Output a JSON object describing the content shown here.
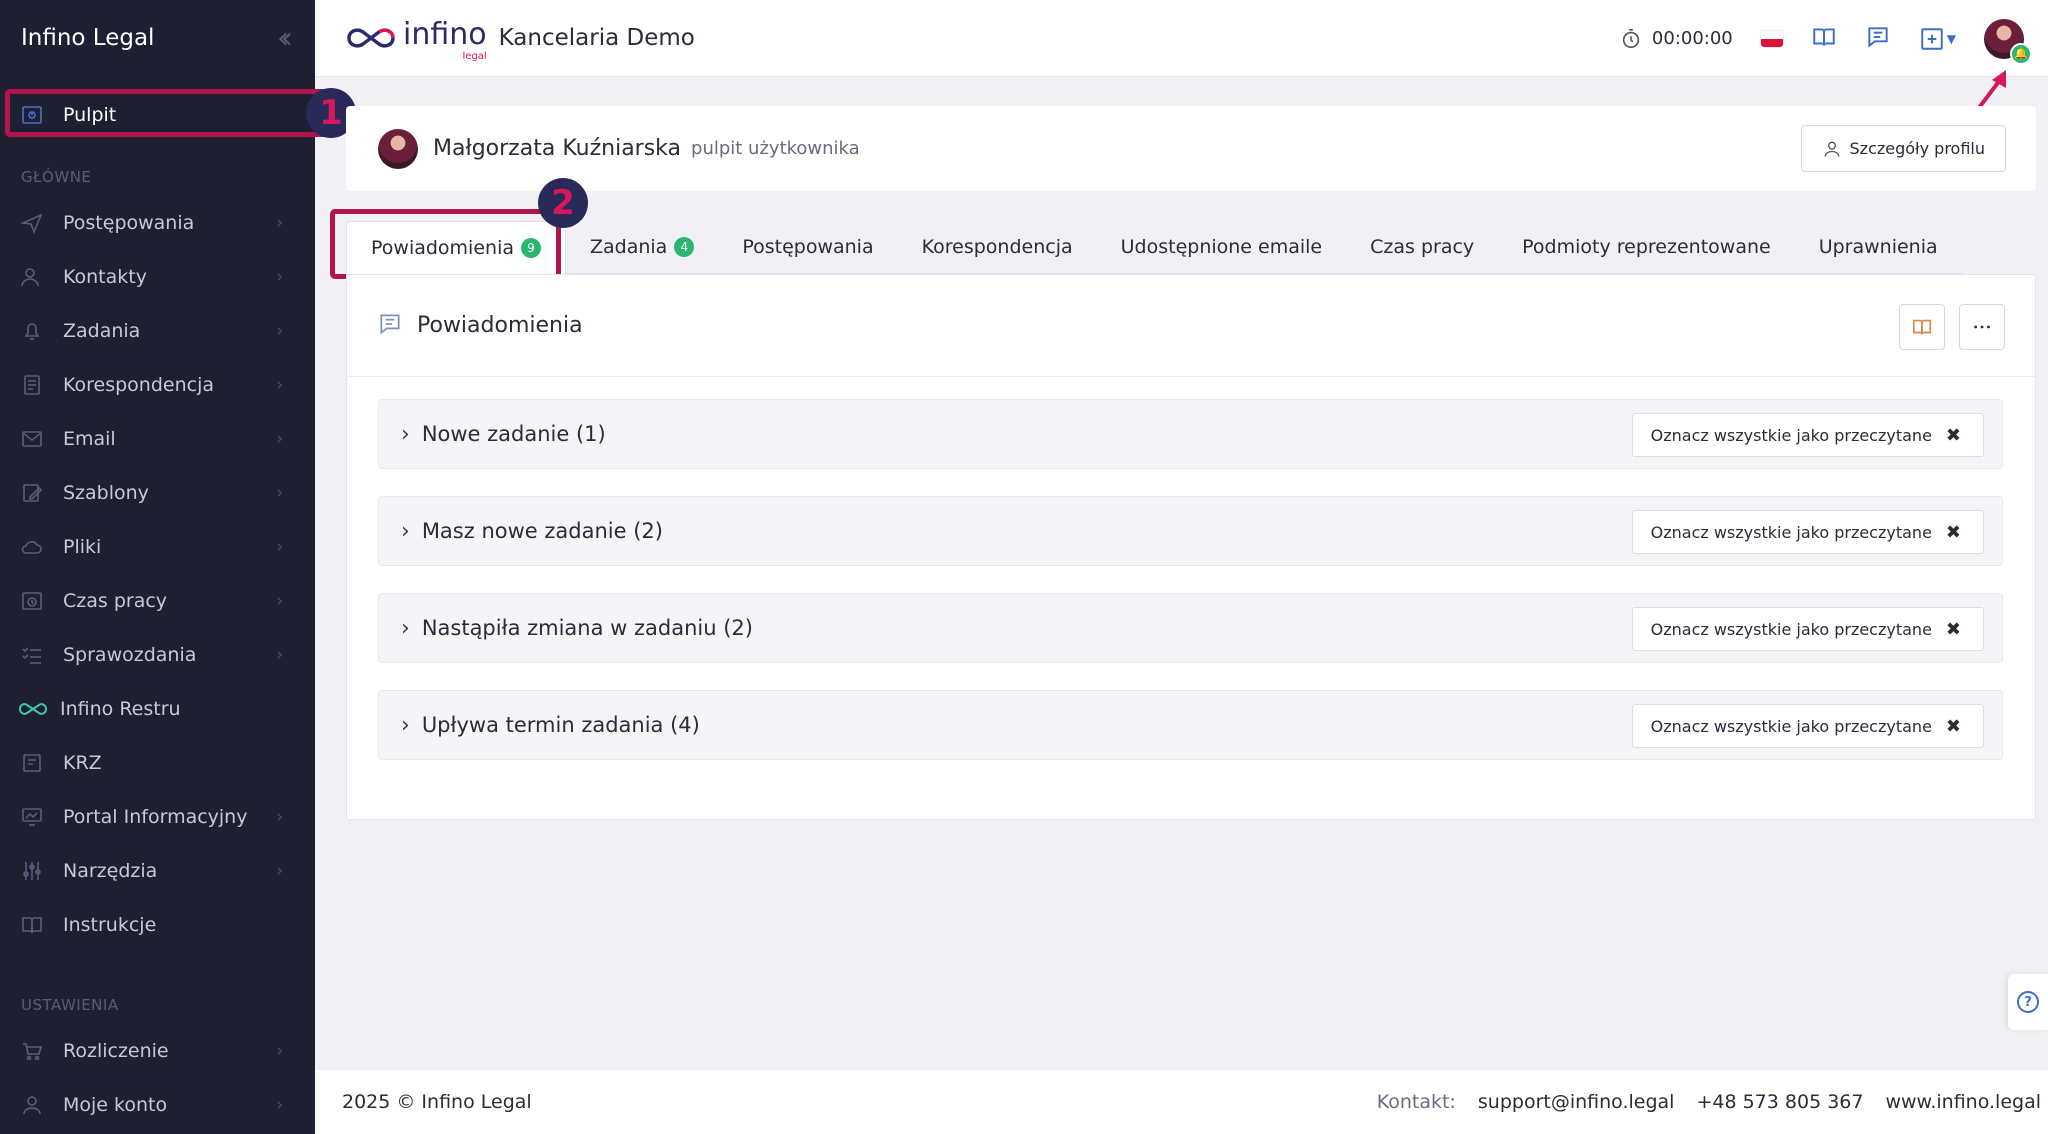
{
  "sidebar": {
    "title": "Infino Legal",
    "active_item": "Pulpit",
    "section_main": "GŁÓWNE",
    "section_settings": "USTAWIENIA",
    "items": [
      {
        "label": "Postępowania",
        "icon": "send-icon"
      },
      {
        "label": "Kontakty",
        "icon": "users-icon"
      },
      {
        "label": "Zadania",
        "icon": "bell-icon"
      },
      {
        "label": "Korespondencja",
        "icon": "document-icon"
      },
      {
        "label": "Email",
        "icon": "mail-icon"
      },
      {
        "label": "Szablony",
        "icon": "edit-icon"
      },
      {
        "label": "Pliki",
        "icon": "cloud-icon"
      },
      {
        "label": "Czas pracy",
        "icon": "clock-icon"
      },
      {
        "label": "Sprawozdania",
        "icon": "checklist-icon"
      },
      {
        "label": "Infino Restru",
        "icon": "infinity-icon"
      },
      {
        "label": "KRZ",
        "icon": "folder-icon"
      },
      {
        "label": "Portal Informacyjny",
        "icon": "monitor-icon"
      },
      {
        "label": "Narzędzia",
        "icon": "sliders-icon"
      },
      {
        "label": "Instrukcje",
        "icon": "book-icon"
      }
    ],
    "settings_items": [
      {
        "label": "Rozliczenie",
        "icon": "cart-icon"
      },
      {
        "label": "Moje konto",
        "icon": "user-icon"
      }
    ]
  },
  "annotations": {
    "step1": "1",
    "step2": "2"
  },
  "topbar": {
    "logo_word": "infino",
    "logo_sub": "legal",
    "office": "Kancelaria Demo",
    "timer": "00:00:00"
  },
  "profile": {
    "name": "Małgorzata Kuźniarska",
    "subtitle": "pulpit użytkownika",
    "details_button": "Szczegóły profilu"
  },
  "tabs": [
    {
      "label": "Powiadomienia",
      "count": "9"
    },
    {
      "label": "Zadania",
      "count": "4"
    },
    {
      "label": "Postępowania"
    },
    {
      "label": "Korespondencja"
    },
    {
      "label": "Udostępnione emaile"
    },
    {
      "label": "Czas pracy"
    },
    {
      "label": "Podmioty reprezentowane"
    },
    {
      "label": "Uprawnienia"
    }
  ],
  "notifications": {
    "title": "Powiadomienia",
    "mark_all_label": "Oznacz wszystkie jako przeczytane",
    "groups": [
      {
        "title": "Nowe zadanie (1)"
      },
      {
        "title": "Masz nowe zadanie (2)"
      },
      {
        "title": "Nastąpiła zmiana w zadaniu (2)"
      },
      {
        "title": "Upływa termin zadania (4)"
      }
    ]
  },
  "footer": {
    "copyright": "2025 © Infino Legal",
    "contact_label": "Kontakt:",
    "email": "support@infino.legal",
    "phone": "+48 573 805 367",
    "website": "www.infino.legal"
  },
  "colors": {
    "accent": "#b3144d",
    "success": "#2bb673",
    "sidebar_bg": "#1f1f32",
    "link_blue": "#3d6fc7"
  }
}
